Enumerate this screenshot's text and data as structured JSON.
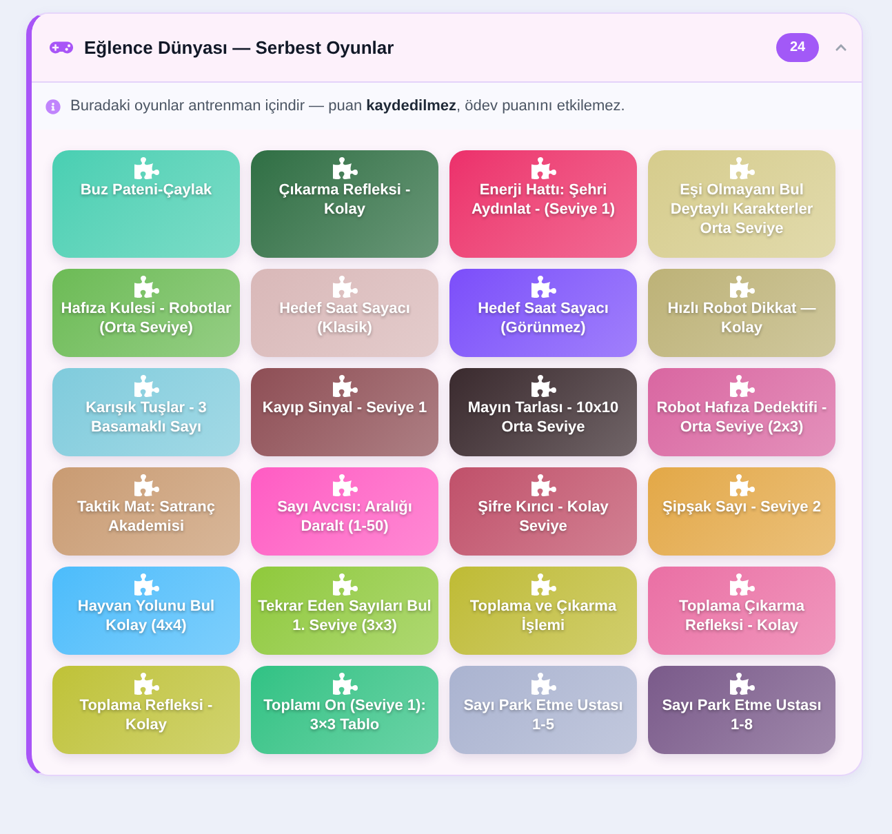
{
  "panel": {
    "title": "Eğlence Dünyası — Serbest Oyunlar",
    "count": "24",
    "expanded": true
  },
  "notice": {
    "text": "Buradaki oyunlar antrenman içindir — puan **kaydedilmez**, ödev puanını etkilemez."
  },
  "games": [
    {
      "title": "Buz Pateni-Çaylak",
      "color": "#48cfb2"
    },
    {
      "title": "Çıkarma Refleksi - Kolay",
      "color": "#2f6f44"
    },
    {
      "title": "Enerji Hattı: Şehri Aydınlat - (Seviye 1)",
      "color": "#ec2f6b"
    },
    {
      "title": "Eşi Olmayanı Bul Deytaylı Karakterler Orta Seviye",
      "color": "#d6cc8c"
    },
    {
      "title": "Hafıza Kulesi - Robotlar (Orta Seviye)",
      "color": "#6cbb55"
    },
    {
      "title": "Hedef Saat Sayacı (Klasik)",
      "color": "#d9b8b8"
    },
    {
      "title": "Hedef Saat Sayacı (Görünmez)",
      "color": "#7c4dfa"
    },
    {
      "title": "Hızlı Robot Dikkat — Kolay",
      "color": "#bdb277"
    },
    {
      "title": "Karışık Tuşlar - 3 Basamaklı Sayı",
      "color": "#7fcbdc"
    },
    {
      "title": "Kayıp Sinyal - Seviye 1",
      "color": "#8e4e55"
    },
    {
      "title": "Mayın Tarlası - 10x10 Orta Seviye",
      "color": "#3a2a2e"
    },
    {
      "title": "Robot Hafıza Dedektifi - Orta Seviye (2x3)",
      "color": "#d966a1"
    },
    {
      "title": "Taktik Mat: Satranç Akademisi",
      "color": "#c99b72"
    },
    {
      "title": "Sayı Avcısı: Aralığı Daralt (1-50)",
      "color": "#ff5bc3"
    },
    {
      "title": "Şifre Kırıcı - Kolay Seviye",
      "color": "#c0506a"
    },
    {
      "title": "Şipşak Sayı - Seviye 2",
      "color": "#e3a846"
    },
    {
      "title": "Hayvan Yolunu Bul Kolay (4x4)",
      "color": "#4bbcfb"
    },
    {
      "title": "Tekrar Eden Sayıları Bul 1. Seviye (3x3)",
      "color": "#8fc93a"
    },
    {
      "title": "Toplama ve Çıkarma İşlemi",
      "color": "#bfbb33"
    },
    {
      "title": "Toplama Çıkarma Refleksi - Kolay",
      "color": "#ea6fa4"
    },
    {
      "title": "Toplama Refleksi - Kolay",
      "color": "#bfc236"
    },
    {
      "title": "Toplamı On (Seviye 1): 3×3 Tablo",
      "color": "#2fc284"
    },
    {
      "title": "Sayı Park Etme Ustası 1-5",
      "color": "#aab3d0"
    },
    {
      "title": "Sayı Park Etme Ustası 1-8",
      "color": "#7a5a8a"
    }
  ]
}
